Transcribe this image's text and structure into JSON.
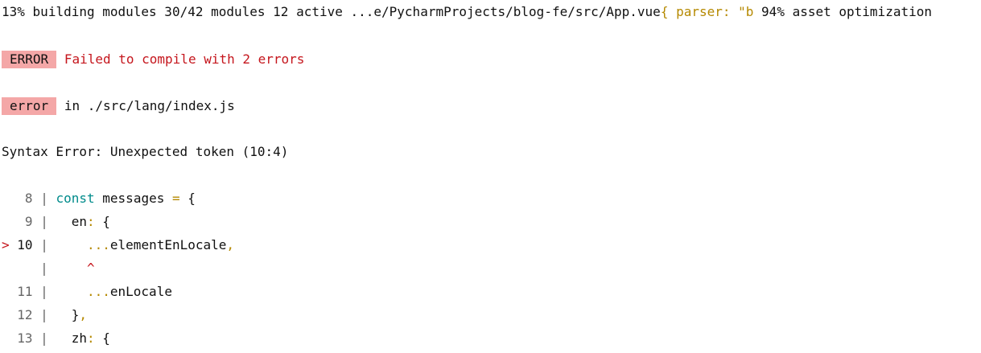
{
  "progress": {
    "pct1": "13%",
    "stage1": "building modules 30/42 modules 12 active ...e/PycharmProjects/blog-fe/src/App.vue",
    "fragment": "{ parser: \"b",
    "pct2": "94%",
    "stage2": "asset optimization"
  },
  "error_header": {
    "badge": "ERROR",
    "message": "Failed to compile with 2 errors"
  },
  "error_entry": {
    "badge": "error",
    "location": "in ./src/lang/index.js"
  },
  "syntax_error": "Syntax Error: Unexpected token (10:4)",
  "code": {
    "line8": {
      "num": "8",
      "sep": "|",
      "keyword": "const",
      "ident": "messages",
      "op": "=",
      "brace": "{"
    },
    "line9": {
      "num": "9",
      "sep": "|",
      "key": "en",
      "colon": ":",
      "brace": "{"
    },
    "line10": {
      "marker": ">",
      "num": "10",
      "sep": "|",
      "spread": "...",
      "ident": "elementEnLocale",
      "comma": ","
    },
    "caret": {
      "sep": "|",
      "caret": "^"
    },
    "line11": {
      "num": "11",
      "sep": "|",
      "spread": "...",
      "ident": "enLocale"
    },
    "line12": {
      "num": "12",
      "sep": "|",
      "brace": "}",
      "comma": ","
    },
    "line13": {
      "num": "13",
      "sep": "|",
      "key": "zh",
      "colon": ":",
      "brace": "{"
    }
  },
  "colors": {
    "badge_bg": "#f4a7a7",
    "error_red": "#c5161d",
    "keyword_teal": "#008b8b",
    "punct_yellow": "#b58900"
  }
}
